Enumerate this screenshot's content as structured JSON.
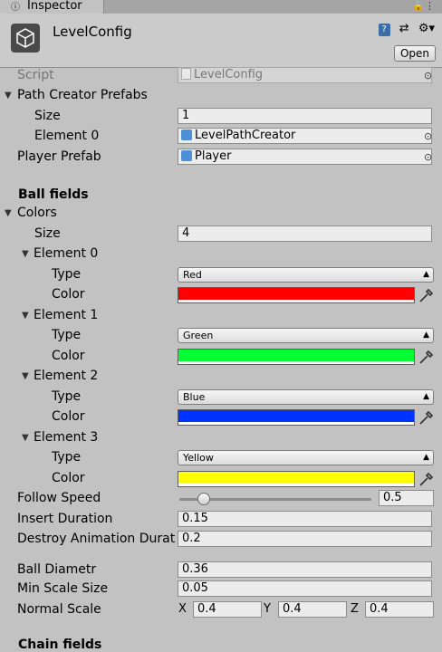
{
  "tab": {
    "label": "Inspector"
  },
  "header": {
    "title": "LevelConfig",
    "open_label": "Open"
  },
  "fields": {
    "script": {
      "label": "Script",
      "value": "LevelConfig"
    },
    "path_creator_prefabs": {
      "label": "Path Creator Prefabs",
      "size_label": "Size",
      "size": "1",
      "element0_label": "Element 0",
      "element0_value": "LevelPathCreator"
    },
    "player_prefab": {
      "label": "Player Prefab",
      "value": "Player"
    },
    "ball_fields_header": "Ball fields",
    "colors": {
      "label": "Colors",
      "size_label": "Size",
      "size": "4",
      "type_label": "Type",
      "color_label": "Color",
      "elements": [
        {
          "label": "Element 0",
          "type": "Red",
          "color": "#ff0000"
        },
        {
          "label": "Element 1",
          "type": "Green",
          "color": "#00ff33"
        },
        {
          "label": "Element 2",
          "type": "Blue",
          "color": "#0033ff"
        },
        {
          "label": "Element 3",
          "type": "Yellow",
          "color": "#ffff00"
        }
      ]
    },
    "follow_speed": {
      "label": "Follow Speed",
      "value": "0.5",
      "fraction": 0.1
    },
    "insert_duration": {
      "label": "Insert Duration",
      "value": "0.15"
    },
    "destroy_animation_duration": {
      "label": "Destroy Animation Durat",
      "value": "0.2"
    },
    "ball_diametr": {
      "label": "Ball Diametr",
      "value": "0.36"
    },
    "min_scale_size": {
      "label": "Min Scale Size",
      "value": "0.05"
    },
    "normal_scale": {
      "label": "Normal Scale",
      "x_label": "X",
      "x": "0.4",
      "y_label": "Y",
      "y": "0.4",
      "z_label": "Z",
      "z": "0.4"
    },
    "next_header_cutoff": "Chain fields"
  }
}
